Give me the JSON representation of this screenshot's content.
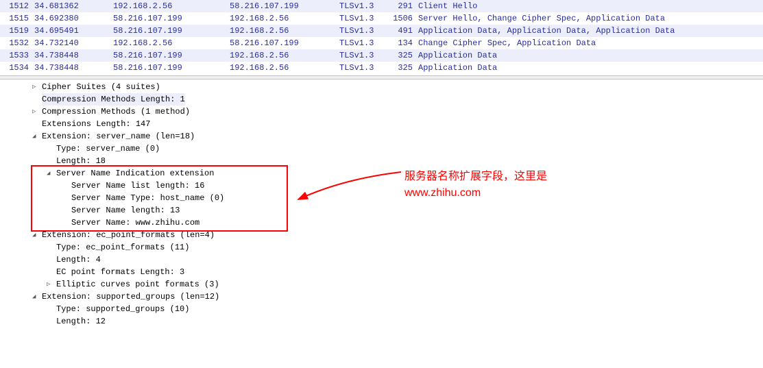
{
  "packets": [
    {
      "no": "1512",
      "time": "34.681362",
      "src": "192.168.2.56",
      "dst": "58.216.107.199",
      "proto": "TLSv1.3",
      "len": "291",
      "info": "Client Hello",
      "alt": true
    },
    {
      "no": "1515",
      "time": "34.692380",
      "src": "58.216.107.199",
      "dst": "192.168.2.56",
      "proto": "TLSv1.3",
      "len": "1506",
      "info": "Server Hello, Change Cipher Spec, Application Data",
      "alt": false
    },
    {
      "no": "1519",
      "time": "34.695491",
      "src": "58.216.107.199",
      "dst": "192.168.2.56",
      "proto": "TLSv1.3",
      "len": "491",
      "info": "Application Data, Application Data, Application Data",
      "alt": true
    },
    {
      "no": "1532",
      "time": "34.732140",
      "src": "192.168.2.56",
      "dst": "58.216.107.199",
      "proto": "TLSv1.3",
      "len": "134",
      "info": "Change Cipher Spec, Application Data",
      "alt": false
    },
    {
      "no": "1533",
      "time": "34.738448",
      "src": "58.216.107.199",
      "dst": "192.168.2.56",
      "proto": "TLSv1.3",
      "len": "325",
      "info": "Application Data",
      "alt": true
    },
    {
      "no": "1534",
      "time": "34.738448",
      "src": "58.216.107.199",
      "dst": "192.168.2.56",
      "proto": "TLSv1.3",
      "len": "325",
      "info": "Application Data",
      "alt": false
    }
  ],
  "tree": {
    "cipher_suites": "Cipher Suites (4 suites)",
    "compression_methods_length": "Compression Methods Length: 1",
    "compression_methods": "Compression Methods (1 method)",
    "extensions_length": "Extensions Length: 147",
    "ext_server_name": "Extension: server_name (len=18)",
    "type_server_name": "Type: server_name (0)",
    "length_18": "Length: 18",
    "sni_extension": "Server Name Indication extension",
    "sni_list_length": "Server Name list length: 16",
    "sni_type": "Server Name Type: host_name (0)",
    "sni_length": "Server Name length: 13",
    "sni_name": "Server Name: www.zhihu.com",
    "ext_ec_point": "Extension: ec_point_formats (len=4)",
    "type_ec_point": "Type: ec_point_formats (11)",
    "length_4": "Length: 4",
    "ec_point_formats_length": "EC point formats Length: 3",
    "elliptic_curves": "Elliptic curves point formats (3)",
    "ext_supported_groups": "Extension: supported_groups (len=12)",
    "type_supported_groups": "Type: supported_groups (10)",
    "length_12": "Length: 12"
  },
  "annotation": {
    "line1": "服务器名称扩展字段，这里是",
    "line2": "www.zhihu.com"
  },
  "glyphs": {
    "closed": "▷",
    "open": "◢"
  }
}
